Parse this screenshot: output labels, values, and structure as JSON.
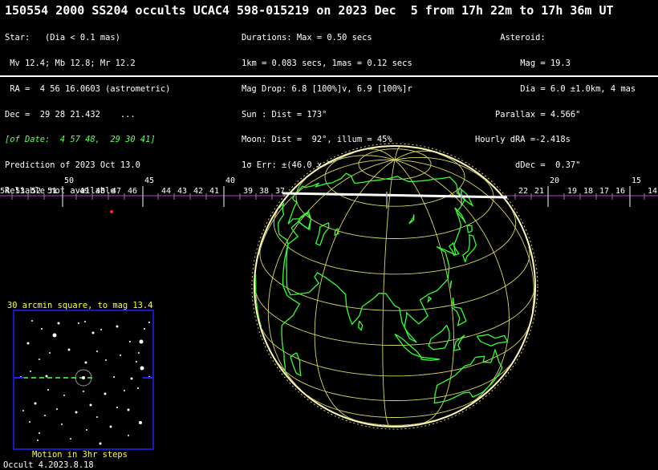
{
  "title": "150554 2000 SS204 occults UCAC4 598-015219 on 2023 Dec  5 from 17h 22m to 17h 36m UT",
  "star_lines": [
    "Star:   (Dia < 0.1 mas)",
    " Mv 12.4; Mb 12.8; Mr 12.2",
    " RA =  4 56 16.0603 (astrometric)",
    "Dec =  29 28 21.432    ...",
    "[of Date:  4 57 48,  29 30 41]",
    "Prediction of 2023 Oct 13.0",
    "Reliable not available"
  ],
  "event_lines": [
    "Durations: Max = 0.50 secs",
    "1km = 0.083 secs, 1mas = 0.12 secs",
    "Mag Drop: 6.8 [100%]v, 6.9 [100%]r",
    "Sun : Dist = 173°",
    "Moon: Dist =  92°, illum = 45%",
    "1σ Err: ±(46.0 x 27.0) mas in PA 79°"
  ],
  "asteroid_lines": [
    "     Asteroid:",
    "         Mag = 19.3",
    "         Dia = 6.0 ±1.0km, 4 mas",
    "    Parallax = 4.566\"",
    "Hourly dRA =-2.418s",
    "        dDec =  0.37\""
  ],
  "colors": {
    "background": "#000000",
    "coastline": "#33ff33",
    "grid": "#d8d860",
    "track": "#ffffff",
    "timeline": "#7a2a8a",
    "inset_frame": "#2020ff",
    "inset_label": "#ffff33"
  },
  "timeline_labels": {
    "row_low": [
      "54",
      "53",
      "52",
      "51",
      "49",
      "48",
      "47",
      "46",
      "44",
      "43",
      "42",
      "41",
      "39",
      "38",
      "37",
      "22",
      "21",
      "19",
      "18",
      "17",
      "16",
      "14"
    ],
    "row_high": [
      "50",
      "45",
      "40",
      "20",
      "15"
    ]
  },
  "inset": {
    "top_label": "30 arcmin square, to mag 13.4",
    "bottom_label": "Motion in 3hr steps"
  },
  "footer": "Occult 4.2023.8.18"
}
